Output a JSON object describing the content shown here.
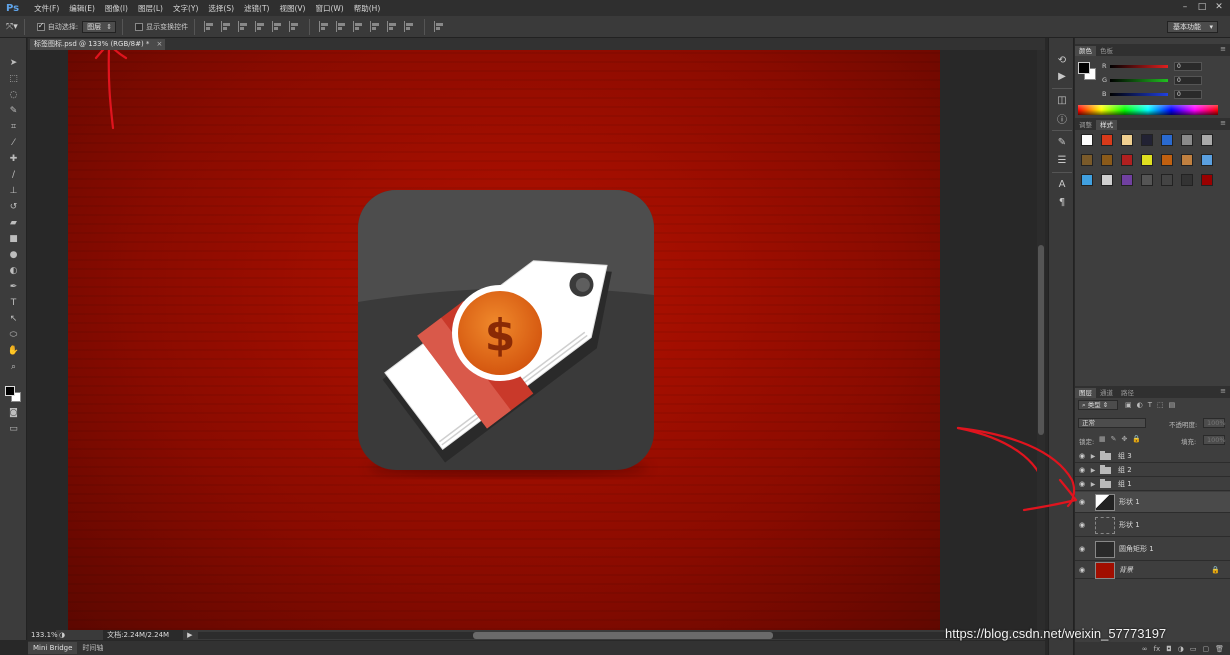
{
  "app": {
    "logo": "Ps",
    "menus": [
      "文件(F)",
      "编辑(E)",
      "图像(I)",
      "图层(L)",
      "文字(Y)",
      "选择(S)",
      "滤镜(T)",
      "视图(V)",
      "窗口(W)",
      "帮助(H)"
    ]
  },
  "window_controls": [
    "minimize-icon",
    "maximize-icon",
    "close-icon"
  ],
  "options": {
    "auto_select_label": "自动选择:",
    "auto_select_checked": true,
    "auto_select_target": "图层",
    "show_transform_label": "显示变换控件",
    "show_transform_checked": false,
    "workspace": "基本功能"
  },
  "document": {
    "tab_title": "标签图标.psd @ 133% (RGB/8#) *",
    "zoom": "133.1%",
    "doc_info": "文档:2.24M/2.24M"
  },
  "bottom_tabs": [
    "Mini Bridge",
    "时间轴"
  ],
  "color_panel": {
    "tabs": [
      "颜色",
      "色板"
    ],
    "sliders": [
      {
        "label": "R",
        "value": "0",
        "color": "#e02020"
      },
      {
        "label": "G",
        "value": "0",
        "color": "#20c020"
      },
      {
        "label": "B",
        "value": "0",
        "color": "#2040e0"
      }
    ]
  },
  "styles_panel": {
    "tabs": [
      "调整",
      "样式"
    ]
  },
  "layers_panel": {
    "tabs": [
      "图层",
      "通道",
      "路径"
    ],
    "kind_filter": "类型",
    "blend_mode": "正常",
    "opacity_label": "不透明度:",
    "opacity_value": "100%",
    "lock_label": "锁定:",
    "fill_label": "填充:",
    "fill_value": "100%",
    "layers": [
      {
        "name": "组 3",
        "type": "group"
      },
      {
        "name": "组 2",
        "type": "group"
      },
      {
        "name": "组 1",
        "type": "group"
      },
      {
        "name": "形状 1",
        "type": "shape",
        "selected": true
      },
      {
        "name": "形状 1",
        "type": "path"
      },
      {
        "name": "圆角矩形 1",
        "type": "shape"
      },
      {
        "name": "背景",
        "type": "background"
      }
    ]
  },
  "watermark": "https://blog.csdn.net/weixin_57773197",
  "icon": {
    "symbol": "$"
  },
  "colors": {
    "canvas_red": "#a10e00",
    "icon_dark": "#3c3c3c",
    "tag_red": "#c9392a",
    "coin_orange": "#e8651a",
    "annotation_red": "#e0141e"
  }
}
